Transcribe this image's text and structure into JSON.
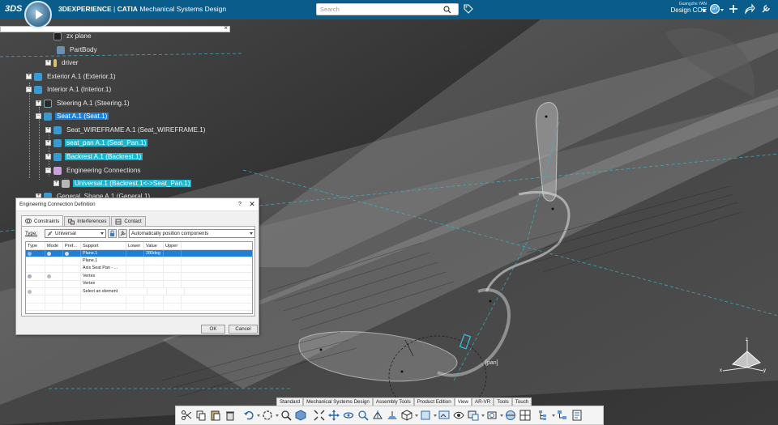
{
  "app": {
    "brand": "3DEXPERIENCE",
    "product": "CATIA",
    "app_name": "Mechanical Systems Design",
    "user": "Guangzhe YAN",
    "role": "Design COE",
    "avatar_initials": "GY"
  },
  "search": {
    "placeholder": "Search"
  },
  "tree": {
    "nodes": [
      {
        "label": "zx plane",
        "state": "normal"
      },
      {
        "label": "PartBody",
        "state": "normal"
      },
      {
        "label": "driver",
        "state": "normal"
      },
      {
        "label": "Exterior A.1 (Exterior.1)",
        "state": "normal"
      },
      {
        "label": "Interior A.1 (Interior.1)",
        "state": "normal"
      },
      {
        "label": "Steering A.1 (Steering.1)",
        "state": "normal"
      },
      {
        "label": "Seat A.1 (Seat.1)",
        "state": "selected"
      },
      {
        "label": "Seat_WIREFRAME A.1 (Seat_WIREFRAME.1)",
        "state": "normal"
      },
      {
        "label": "seat_pan A.1 (Seat_Pan.1)",
        "state": "highlight"
      },
      {
        "label": "Backrest A.1 (Backrest.1)",
        "state": "highlight"
      },
      {
        "label": "Engineering Connections",
        "state": "normal"
      },
      {
        "label": "Universal.1 (Backrest.1<->Seat_Pan.1)",
        "state": "highlight"
      },
      {
        "label": "General_Shape A.1 (General.1)",
        "state": "normal"
      }
    ]
  },
  "dialog": {
    "title": "Engineering Connection Definition",
    "help": "?",
    "close": "✕",
    "tabs": [
      "Constraints",
      "Interferences",
      "Contact"
    ],
    "type_label": "Type:",
    "type_value": "Universal",
    "positioning": "Automatically position components",
    "columns": [
      "Type",
      "Mode",
      "Pref...",
      "Support",
      "Lower",
      "Value",
      "Upper"
    ],
    "rows": [
      {
        "support": "Plane.1",
        "value": "280deg",
        "selected": true
      },
      {
        "support": "Plane.1",
        "value": "",
        "selected": false
      },
      {
        "support": "Axis Seat Pan - ...",
        "value": "",
        "selected": false
      },
      {
        "support": "Vertex",
        "value": "",
        "selected": false
      },
      {
        "support": "Vertex",
        "value": "",
        "selected": false
      },
      {
        "support": "Select an element",
        "value": "",
        "selected": false
      },
      {
        "support": "",
        "value": "",
        "selected": false
      },
      {
        "support": "",
        "value": "",
        "selected": false
      }
    ],
    "ok": "OK",
    "cancel": "Cancel"
  },
  "action_bar": {
    "tabs": [
      "Standard",
      "Mechanical Systems Design",
      "Assembly Tools",
      "Product Edition",
      "View",
      "AR-VR",
      "Tools",
      "Touch"
    ],
    "active_tab": "View"
  },
  "viewport": {
    "label": "[pan]",
    "axes": {
      "x": "x",
      "y": "y",
      "z": "z"
    }
  },
  "colors": {
    "topbar": "#0a5c8a",
    "highlight": "#19b6cf",
    "selection": "#1f7fd6",
    "background": "#3a3a3a"
  }
}
